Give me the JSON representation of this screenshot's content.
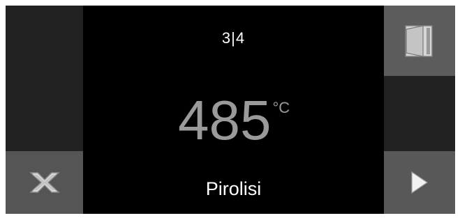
{
  "display": {
    "step": "3|4",
    "temperature": "485",
    "unit": "°C",
    "program": "Pirolisi"
  },
  "icons": {
    "cancel": "close-x-icon",
    "door": "door-icon",
    "next": "play-arrow-icon"
  },
  "colors": {
    "background": "#000000",
    "button_dark": "#222222",
    "button_grey": "#5a5a5a",
    "temperature_text": "#9a9a9a",
    "text": "#ffffff"
  }
}
